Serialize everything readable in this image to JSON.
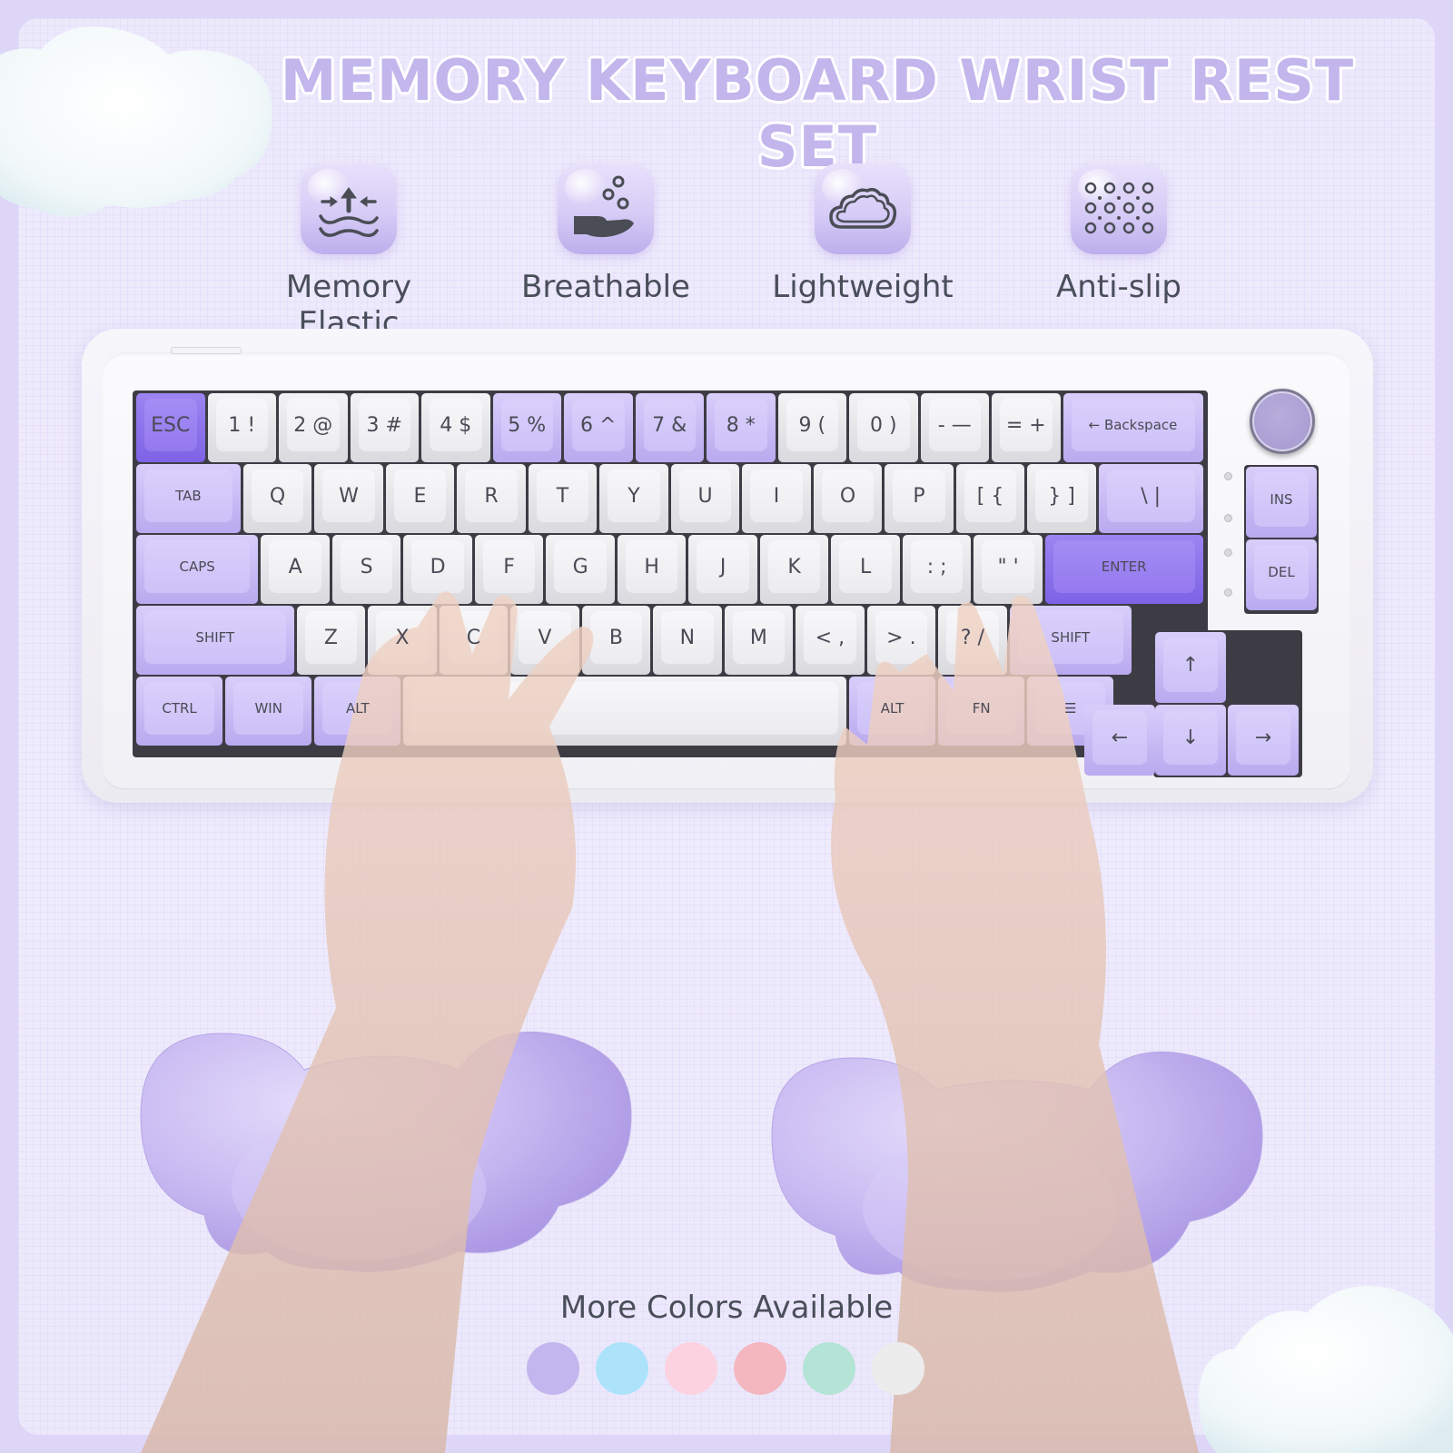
{
  "title": "MEMORY KEYBOARD WRIST REST SET",
  "features": [
    {
      "icon": "compress-waves-icon",
      "label": "Memory Elastic"
    },
    {
      "icon": "hand-bubbles-icon",
      "label": "Breathable"
    },
    {
      "icon": "cloud-icon",
      "label": "Lightweight"
    },
    {
      "icon": "dot-grid-icon",
      "label": "Anti-slip"
    }
  ],
  "keyboard": {
    "rows": [
      [
        {
          "label": "ESC",
          "tone": "dark",
          "size": "l"
        },
        {
          "label": "1 !",
          "tone": "white",
          "size": "l"
        },
        {
          "label": "2 @",
          "tone": "white",
          "size": "l"
        },
        {
          "label": "3 #",
          "tone": "white",
          "size": "l"
        },
        {
          "label": "4 $",
          "tone": "white",
          "size": "l"
        },
        {
          "label": "5 %",
          "tone": "lilac",
          "size": "l"
        },
        {
          "label": "6 ^",
          "tone": "lilac",
          "size": "l"
        },
        {
          "label": "7 &",
          "tone": "lilac",
          "size": "l"
        },
        {
          "label": "8 *",
          "tone": "lilac",
          "size": "l"
        },
        {
          "label": "9 (",
          "tone": "white",
          "size": "l"
        },
        {
          "label": "0 )",
          "tone": "white",
          "size": "l"
        },
        {
          "label": "- —",
          "tone": "white",
          "size": "l"
        },
        {
          "label": "= +",
          "tone": "white",
          "size": "l"
        },
        {
          "label": "← Backspace",
          "tone": "lilac",
          "size": "s"
        }
      ],
      [
        {
          "label": "TAB",
          "tone": "lilac",
          "size": "s"
        },
        {
          "label": "Q",
          "tone": "white",
          "size": "l"
        },
        {
          "label": "W",
          "tone": "white",
          "size": "l"
        },
        {
          "label": "E",
          "tone": "white",
          "size": "l"
        },
        {
          "label": "R",
          "tone": "white",
          "size": "l"
        },
        {
          "label": "T",
          "tone": "white",
          "size": "l"
        },
        {
          "label": "Y",
          "tone": "white",
          "size": "l"
        },
        {
          "label": "U",
          "tone": "white",
          "size": "l"
        },
        {
          "label": "I",
          "tone": "white",
          "size": "l"
        },
        {
          "label": "O",
          "tone": "white",
          "size": "l"
        },
        {
          "label": "P",
          "tone": "white",
          "size": "l"
        },
        {
          "label": "[ {",
          "tone": "white",
          "size": "l"
        },
        {
          "label": "} ]",
          "tone": "white",
          "size": "l"
        },
        {
          "label": "\\ |",
          "tone": "lilac",
          "size": "l"
        }
      ],
      [
        {
          "label": "CAPS",
          "tone": "lilac",
          "size": "s"
        },
        {
          "label": "A",
          "tone": "white",
          "size": "l"
        },
        {
          "label": "S",
          "tone": "white",
          "size": "l"
        },
        {
          "label": "D",
          "tone": "white",
          "size": "l"
        },
        {
          "label": "F",
          "tone": "white",
          "size": "l"
        },
        {
          "label": "G",
          "tone": "white",
          "size": "l"
        },
        {
          "label": "H",
          "tone": "white",
          "size": "l"
        },
        {
          "label": "J",
          "tone": "white",
          "size": "l"
        },
        {
          "label": "K",
          "tone": "white",
          "size": "l"
        },
        {
          "label": "L",
          "tone": "white",
          "size": "l"
        },
        {
          "label": ": ;",
          "tone": "white",
          "size": "l"
        },
        {
          "label": "\" '",
          "tone": "white",
          "size": "l"
        },
        {
          "label": "ENTER",
          "tone": "dark",
          "size": "s"
        }
      ],
      [
        {
          "label": "SHIFT",
          "tone": "lilac",
          "size": "s"
        },
        {
          "label": "Z",
          "tone": "white",
          "size": "l"
        },
        {
          "label": "X",
          "tone": "white",
          "size": "l"
        },
        {
          "label": "C",
          "tone": "white",
          "size": "l"
        },
        {
          "label": "V",
          "tone": "white",
          "size": "l"
        },
        {
          "label": "B",
          "tone": "white",
          "size": "l"
        },
        {
          "label": "N",
          "tone": "white",
          "size": "l"
        },
        {
          "label": "M",
          "tone": "white",
          "size": "l"
        },
        {
          "label": "< ,",
          "tone": "white",
          "size": "l"
        },
        {
          "label": "> .",
          "tone": "white",
          "size": "l"
        },
        {
          "label": "? /",
          "tone": "white",
          "size": "l"
        },
        {
          "label": "SHIFT",
          "tone": "lilac",
          "size": "s"
        }
      ],
      [
        {
          "label": "CTRL",
          "tone": "lilac",
          "size": "s"
        },
        {
          "label": "WIN",
          "tone": "lilac",
          "size": "s"
        },
        {
          "label": "ALT",
          "tone": "lilac",
          "size": "s"
        },
        {
          "label": "",
          "tone": "white",
          "size": "s"
        },
        {
          "label": "ALT",
          "tone": "lilac",
          "size": "s"
        },
        {
          "label": "FN",
          "tone": "lilac",
          "size": "s"
        },
        {
          "label": "☰",
          "tone": "lilac",
          "size": "s"
        }
      ]
    ],
    "side_keys": [
      {
        "label": "INS",
        "tone": "lilac",
        "size": "s"
      },
      {
        "label": "DEL",
        "tone": "lilac",
        "size": "s"
      }
    ],
    "arrow_keys": [
      {
        "label": "↑",
        "tone": "lilac",
        "size": "l"
      },
      {
        "label": "←",
        "tone": "lilac",
        "size": "l"
      },
      {
        "label": "↓",
        "tone": "lilac",
        "size": "l"
      },
      {
        "label": "→",
        "tone": "lilac",
        "size": "l"
      }
    ]
  },
  "colors_section": {
    "label": "More Colors Available",
    "swatches": [
      {
        "name": "purple",
        "hex": "#c3b6ee"
      },
      {
        "name": "blue",
        "hex": "#ace3fb"
      },
      {
        "name": "pink",
        "hex": "#fcd2e0"
      },
      {
        "name": "coral",
        "hex": "#f4b7bf"
      },
      {
        "name": "mint",
        "hex": "#b3e4d6"
      },
      {
        "name": "white",
        "hex": "#ececec"
      }
    ]
  },
  "theme": {
    "accent": "#c2b6ec",
    "dark_accent": "#8b70ec",
    "text": "#4a4e5a"
  }
}
